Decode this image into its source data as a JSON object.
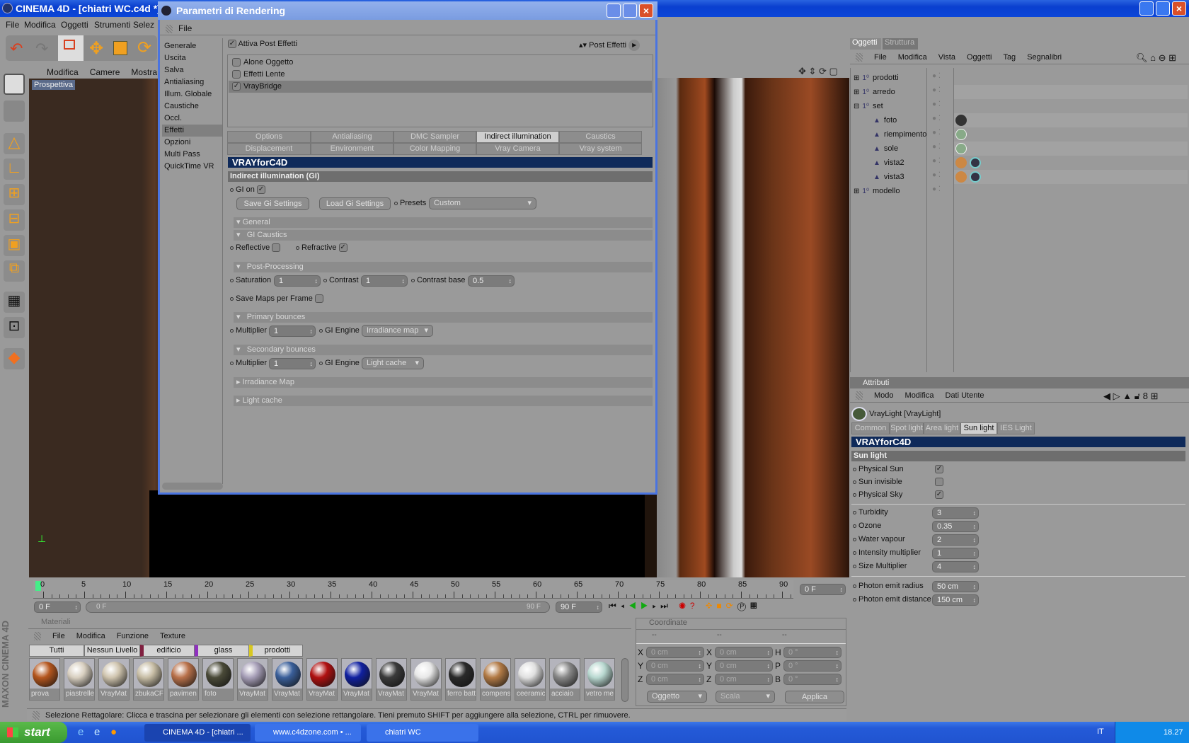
{
  "app": {
    "title": "CINEMA 4D - [chiatri WC.c4d *]",
    "menu": [
      "File",
      "Modifica",
      "Oggetti",
      "Strumenti",
      "Selez"
    ]
  },
  "viewport": {
    "menu": [
      "Modifica",
      "Camere",
      "Mostra",
      "F"
    ],
    "label": "Prospettiva"
  },
  "render_dialog": {
    "title": "Parametri di Rendering",
    "menu": "File",
    "sidebar": [
      "Generale",
      "Uscita",
      "Salva",
      "Antialiasing",
      "Illum. Globale",
      "Caustiche",
      "Occl. Ambientale",
      "Effetti",
      "Opzioni",
      "Multi Pass",
      "QuickTime VR"
    ],
    "selected_sidebar": "Effetti",
    "activate_post": "Attiva Post Effetti",
    "post_effects_label": "Post Effetti",
    "effects": [
      {
        "label": "Alone Oggetto",
        "checked": false
      },
      {
        "label": "Effetti Lente",
        "checked": false
      },
      {
        "label": "VrayBridge",
        "checked": true
      }
    ],
    "tabs_row1": [
      "Options",
      "Antialiasing",
      "DMC Sampler",
      "Indirect illumination (GI)",
      "Caustics"
    ],
    "tabs_row2": [
      "Displacement",
      "Environment",
      "Color Mapping",
      "Vray Camera",
      "Vray system"
    ],
    "active_tab": "Indirect illumination (GI)",
    "banner": "VRAYforC4D",
    "section": "Indirect illumination (GI)",
    "gi_on": "GI on",
    "save_gi": "Save Gi Settings",
    "load_gi": "Load Gi Settings",
    "presets_label": "Presets",
    "presets_value": "Custom",
    "general": "General",
    "gi_caustics": "GI Caustics",
    "reflective": "Reflective",
    "refractive": "Refractive",
    "post_processing": "Post-Processing",
    "saturation": "Saturation",
    "saturation_value": "1",
    "contrast": "Contrast",
    "contrast_value": "1",
    "contrast_base": "Contrast base",
    "contrast_base_value": "0.5",
    "save_maps": "Save Maps per Frame",
    "primary": "Primary bounces",
    "multiplier": "Multiplier",
    "primary_multiplier": "1",
    "gi_engine": "GI Engine",
    "primary_engine": "Irradiance map",
    "secondary": "Secondary bounces",
    "secondary_multiplier": "1",
    "secondary_engine": "Light cache",
    "irradiance_map": "Irradiance Map",
    "light_cache": "Light cache"
  },
  "objects": {
    "tabs": [
      "Oggetti",
      "Struttura"
    ],
    "menu": [
      "File",
      "Modifica",
      "Vista",
      "Oggetti",
      "Tag",
      "Segnalibri"
    ],
    "tree": [
      {
        "name": "prodotti",
        "level": 0
      },
      {
        "name": "arredo",
        "level": 0
      },
      {
        "name": "set",
        "level": 0
      },
      {
        "name": "foto",
        "level": 1
      },
      {
        "name": "riempimento",
        "level": 1
      },
      {
        "name": "sole",
        "level": 1
      },
      {
        "name": "vista2",
        "level": 1
      },
      {
        "name": "vista3",
        "level": 1
      },
      {
        "name": "modello",
        "level": 0
      }
    ]
  },
  "attributes": {
    "title": "Attributi",
    "menu": [
      "Modo",
      "Modifica",
      "Dati Utente"
    ],
    "object": "VrayLight [VrayLight]",
    "tabs": [
      "Common",
      "Spot light",
      "Area light",
      "Sun light",
      "IES Light"
    ],
    "active_tab": "Sun light",
    "banner": "VRAYforC4D",
    "section": "Sun light",
    "checks": [
      {
        "label": "Physical Sun",
        "checked": true
      },
      {
        "label": "Sun invisible",
        "checked": false
      },
      {
        "label": "Physical Sky",
        "checked": true
      }
    ],
    "fields": [
      {
        "label": "Turbidity",
        "value": "3"
      },
      {
        "label": "Ozone",
        "value": "0.35"
      },
      {
        "label": "Water vapour",
        "value": "2"
      },
      {
        "label": "Intensity multiplier",
        "value": "1"
      },
      {
        "label": "Size Multiplier",
        "value": "4"
      }
    ],
    "photon": [
      {
        "label": "Photon emit radius",
        "value": "50 cm"
      },
      {
        "label": "Photon emit distance",
        "value": "150 cm"
      }
    ]
  },
  "timeline": {
    "ticks": [
      "0",
      "5",
      "10",
      "15",
      "20",
      "25",
      "30",
      "35",
      "40",
      "45",
      "50",
      "55",
      "60",
      "65",
      "70",
      "75",
      "80",
      "85",
      "90"
    ],
    "current": "0 F",
    "start": "0 F",
    "range_start": "0 F",
    "range_end": "90 F",
    "end": "90 F"
  },
  "materials": {
    "title": "Materiali",
    "menu": [
      "File",
      "Modifica",
      "Funzione",
      "Texture"
    ],
    "layers": [
      "Tutti",
      "Nessun Livello",
      "edificio",
      "glass",
      "prodotti"
    ],
    "items": [
      {
        "name": "prova",
        "color": "#b5561e"
      },
      {
        "name": "piastrelle",
        "color": "#d8cfc0"
      },
      {
        "name": "VrayMat",
        "color": "#cfc4ae"
      },
      {
        "name": "zbukaCF",
        "color": "#c7bda5"
      },
      {
        "name": "pavimen",
        "color": "#b9714a"
      },
      {
        "name": "foto",
        "color": "#4a4a38"
      },
      {
        "name": "VrayMat",
        "color": "#a79fb8"
      },
      {
        "name": "VrayMat",
        "color": "#3a5f9a"
      },
      {
        "name": "VrayMat",
        "color": "#b01010"
      },
      {
        "name": "VrayMat",
        "color": "#1020a0"
      },
      {
        "name": "VrayMat",
        "color": "#3a3a3a"
      },
      {
        "name": "VrayMat",
        "color": "#e8e8e8"
      },
      {
        "name": "ferro batt",
        "color": "#2a2a2a"
      },
      {
        "name": "compens",
        "color": "#b27a45"
      },
      {
        "name": "ceeramic",
        "color": "#e0e0e0"
      },
      {
        "name": "acciaio",
        "color": "#888"
      },
      {
        "name": "vetro me",
        "color": "#b8d8d0"
      }
    ]
  },
  "coordinates": {
    "title": "Coordinate",
    "cols": [
      "--",
      "--",
      "--"
    ],
    "rows": [
      [
        "X",
        "0 cm",
        "X",
        "0 cm",
        "H",
        "0 °"
      ],
      [
        "Y",
        "0 cm",
        "Y",
        "0 cm",
        "P",
        "0 °"
      ],
      [
        "Z",
        "0 cm",
        "Z",
        "0 cm",
        "B",
        "0 °"
      ]
    ],
    "mode": "Oggetto",
    "scale": "Scala",
    "apply": "Applica"
  },
  "status": "Selezione Rettagolare: Clicca e trascina per selezionare gli elementi con selezione rettangolare. Tieni premuto SHIFT per aggiungere alla selezione, CTRL per rimuovere.",
  "taskbar": {
    "start": "start",
    "tasks": [
      "CINEMA 4D - [chiatri ...",
      "www.c4dzone.com • ...",
      "chiatri WC"
    ],
    "lang": "IT",
    "clock": "18.27"
  },
  "side_logo": "MAXON CINEMA 4D"
}
